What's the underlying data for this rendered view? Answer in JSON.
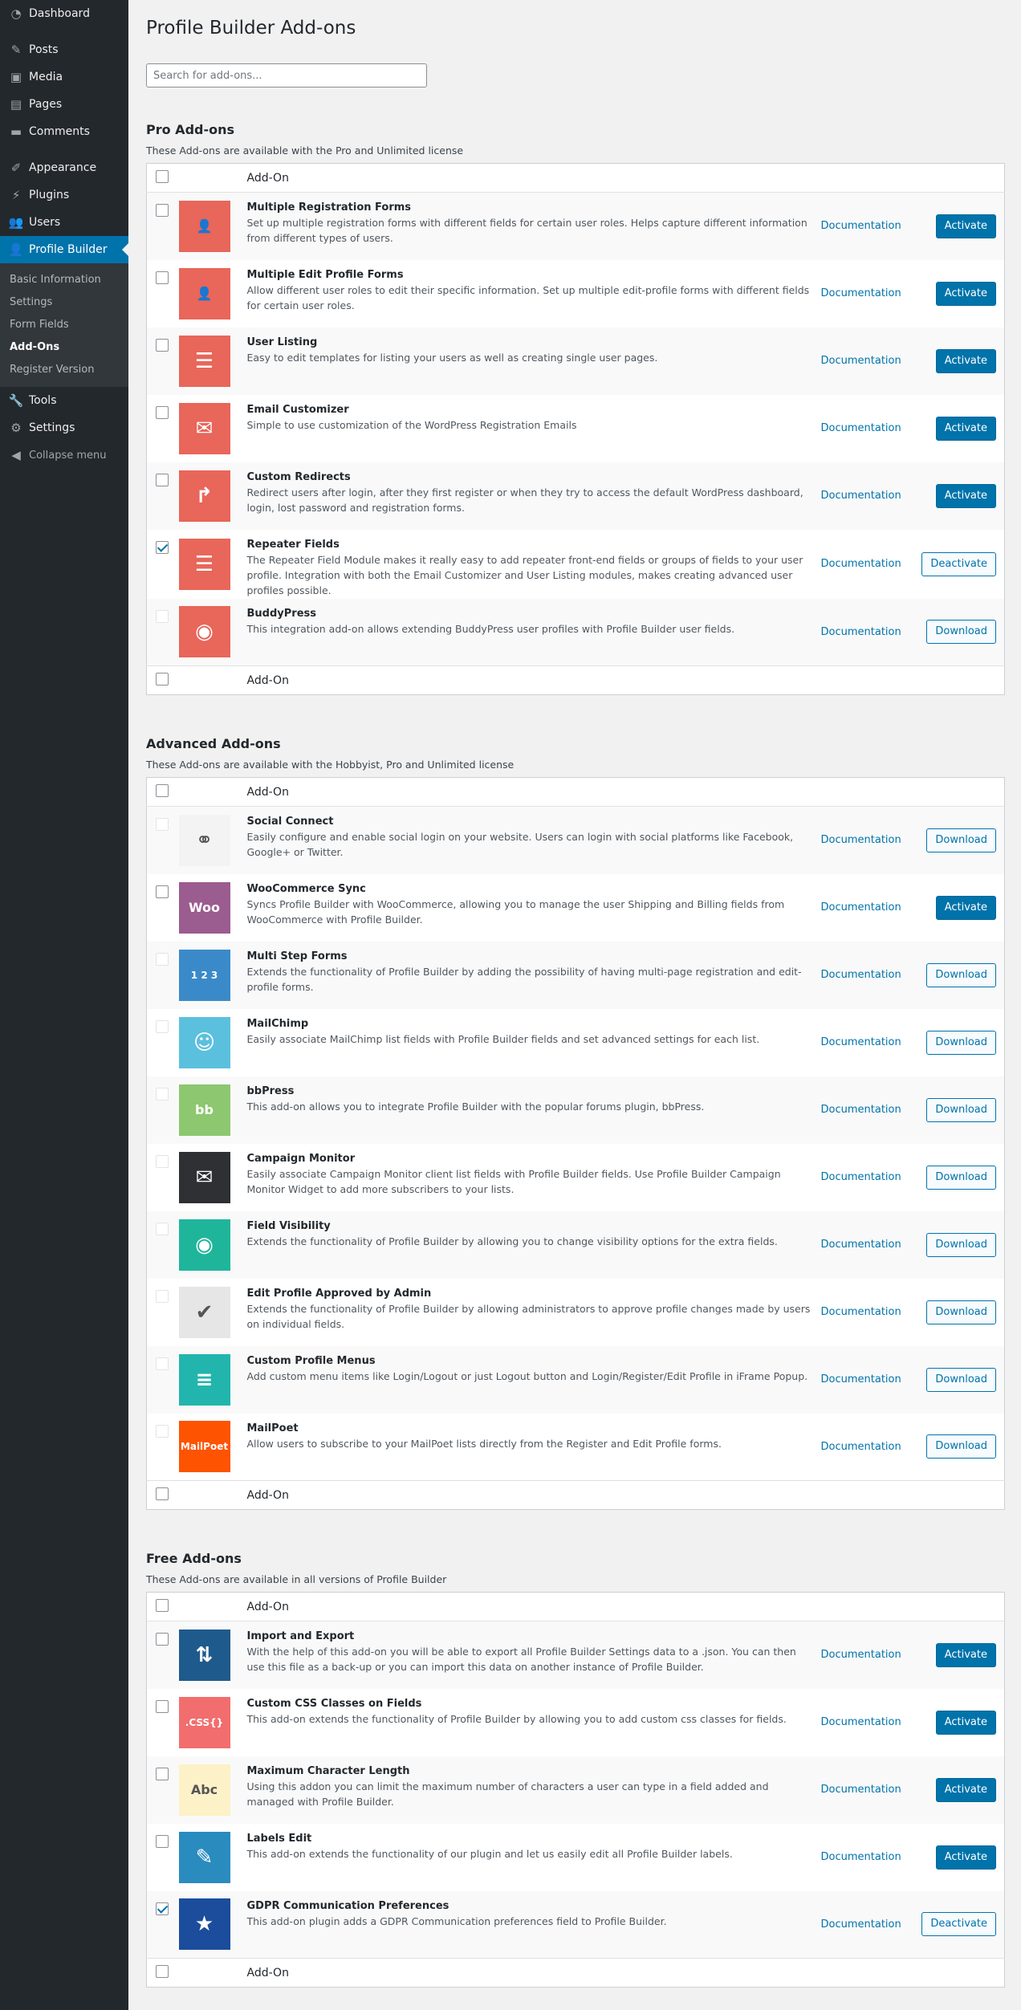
{
  "sidebar": {
    "items": [
      {
        "label": "Dashboard",
        "icon": "dashboard-icon"
      },
      {
        "label": "Posts",
        "icon": "pin-icon"
      },
      {
        "label": "Media",
        "icon": "media-icon"
      },
      {
        "label": "Pages",
        "icon": "pages-icon"
      },
      {
        "label": "Comments",
        "icon": "comments-icon"
      },
      {
        "label": "Appearance",
        "icon": "brush-icon"
      },
      {
        "label": "Plugins",
        "icon": "plug-icon"
      },
      {
        "label": "Users",
        "icon": "users-icon"
      },
      {
        "label": "Profile Builder",
        "icon": "user-icon"
      },
      {
        "label": "Tools",
        "icon": "wrench-icon"
      },
      {
        "label": "Settings",
        "icon": "settings-icon"
      }
    ],
    "submenu": [
      "Basic Information",
      "Settings",
      "Form Fields",
      "Add-Ons",
      "Register Version"
    ],
    "collapse": "Collapse menu"
  },
  "page": {
    "title": "Profile Builder Add-ons",
    "search_placeholder": "Search for add-ons..."
  },
  "labels": {
    "addon_col": "Add-On",
    "documentation": "Documentation"
  },
  "sections": [
    {
      "title": "Pro Add-ons",
      "desc": "These Add-ons are available with the Pro and Unlimited license",
      "addons": [
        {
          "name": "Multiple Registration Forms",
          "desc": "Set up multiple registration forms with different fields for certain user roles. Helps capture different information from different types of users.",
          "action": "Activate",
          "checked": false,
          "disabled": false,
          "color": "#e8665a",
          "glyph": "👤"
        },
        {
          "name": "Multiple Edit Profile Forms",
          "desc": "Allow different user roles to edit their specific information. Set up multiple edit-profile forms with different fields for certain user roles.",
          "action": "Activate",
          "checked": false,
          "disabled": false,
          "color": "#e8665a",
          "glyph": "👤"
        },
        {
          "name": "User Listing",
          "desc": "Easy to edit templates for listing your users as well as creating single user pages.",
          "action": "Activate",
          "checked": false,
          "disabled": false,
          "color": "#e8665a",
          "glyph": "☰"
        },
        {
          "name": "Email Customizer",
          "desc": "Simple to use customization of the WordPress Registration Emails",
          "action": "Activate",
          "checked": false,
          "disabled": false,
          "color": "#e8665a",
          "glyph": "✉"
        },
        {
          "name": "Custom Redirects",
          "desc": "Redirect users after login, after they first register or when they try to access the default WordPress dashboard, login, lost password and registration forms.",
          "action": "Activate",
          "checked": false,
          "disabled": false,
          "color": "#e8665a",
          "glyph": "↱"
        },
        {
          "name": "Repeater Fields",
          "desc": "The Repeater Field Module makes it really easy to add repeater front-end fields or groups of fields to your user profile. Integration with both the Email Customizer and User Listing modules, makes creating advanced user profiles possible.",
          "action": "Deactivate",
          "checked": true,
          "disabled": false,
          "color": "#e8665a",
          "glyph": "☰"
        },
        {
          "name": "BuddyPress",
          "desc": "This integration add-on allows extending BuddyPress user profiles with Profile Builder user fields.",
          "action": "Download",
          "checked": false,
          "disabled": true,
          "color": "#e8665a",
          "glyph": "◉"
        }
      ]
    },
    {
      "title": "Advanced Add-ons",
      "desc": "These Add-ons are available with the Hobbyist, Pro and Unlimited license",
      "addons": [
        {
          "name": "Social Connect",
          "desc": "Easily configure and enable social login on your website. Users can login with social platforms like Facebook, Google+ or Twitter.",
          "action": "Download",
          "checked": false,
          "disabled": true,
          "color": "#f3f3f3",
          "glyph": "⚭"
        },
        {
          "name": "WooCommerce Sync",
          "desc": "Syncs Profile Builder with WooCommerce, allowing you to manage the user Shipping and Billing fields from WooCommerce with Profile Builder.",
          "action": "Activate",
          "checked": false,
          "disabled": false,
          "color": "#9b5c8f",
          "glyph": "Woo"
        },
        {
          "name": "Multi Step Forms",
          "desc": "Extends the functionality of Profile Builder by adding the possibility of having multi-page registration and edit-profile forms.",
          "action": "Download",
          "checked": false,
          "disabled": true,
          "color": "#3a8ac9",
          "glyph": "1 2 3"
        },
        {
          "name": "MailChimp",
          "desc": "Easily associate MailChimp list fields with Profile Builder fields and set advanced settings for each list.",
          "action": "Download",
          "checked": false,
          "disabled": true,
          "color": "#5bc0de",
          "glyph": "☺"
        },
        {
          "name": "bbPress",
          "desc": "This add-on allows you to integrate Profile Builder with the popular forums plugin, bbPress.",
          "action": "Download",
          "checked": false,
          "disabled": true,
          "color": "#8dc770",
          "glyph": "bb"
        },
        {
          "name": "Campaign Monitor",
          "desc": "Easily associate Campaign Monitor client list fields with Profile Builder fields. Use Profile Builder Campaign Monitor Widget to add more subscribers to your lists.",
          "action": "Download",
          "checked": false,
          "disabled": true,
          "color": "#2e3033",
          "glyph": "✉"
        },
        {
          "name": "Field Visibility",
          "desc": "Extends the functionality of Profile Builder by allowing you to change visibility options for the extra fields.",
          "action": "Download",
          "checked": false,
          "disabled": true,
          "color": "#1fb59a",
          "glyph": "◉"
        },
        {
          "name": "Edit Profile Approved by Admin",
          "desc": "Extends the functionality of Profile Builder by allowing administrators to approve profile changes made by users on individual fields.",
          "action": "Download",
          "checked": false,
          "disabled": true,
          "color": "#e6e6e6",
          "glyph": "✔"
        },
        {
          "name": "Custom Profile Menus",
          "desc": "Add custom menu items like Login/Logout or just Logout button and Login/Register/Edit Profile in iFrame Popup.",
          "action": "Download",
          "checked": false,
          "disabled": true,
          "color": "#22b5ad",
          "glyph": "≡"
        },
        {
          "name": "MailPoet",
          "desc": "Allow users to subscribe to your MailPoet lists directly from the Register and Edit Profile forms.",
          "action": "Download",
          "checked": false,
          "disabled": true,
          "color": "#fe5301",
          "glyph": "MailPoet"
        }
      ]
    },
    {
      "title": "Free Add-ons",
      "desc": "These Add-ons are available in all versions of Profile Builder",
      "addons": [
        {
          "name": "Import and Export",
          "desc": "With the help of this add-on you will be able to export all Profile Builder Settings data to a .json. You can then use this file as a back-up or you can import this data on another instance of Profile Builder.",
          "action": "Activate",
          "checked": false,
          "disabled": false,
          "color": "#1f5a8c",
          "glyph": "⇅"
        },
        {
          "name": "Custom CSS Classes on Fields",
          "desc": "This add-on extends the functionality of Profile Builder by allowing you to add custom css classes for fields.",
          "action": "Activate",
          "checked": false,
          "disabled": false,
          "color": "#f26d6d",
          "glyph": ".CSS{}"
        },
        {
          "name": "Maximum Character Length",
          "desc": "Using this addon you can limit the maximum number of characters a user can type in a field added and managed with Profile Builder.",
          "action": "Activate",
          "checked": false,
          "disabled": false,
          "color": "#fdf1c7",
          "glyph": "Abc"
        },
        {
          "name": "Labels Edit",
          "desc": "This add-on extends the functionality of our plugin and let us easily edit all Profile Builder labels.",
          "action": "Activate",
          "checked": false,
          "disabled": false,
          "color": "#2a8bbf",
          "glyph": "✎"
        },
        {
          "name": "GDPR Communication Preferences",
          "desc": "This add-on plugin adds a GDPR Communication preferences field to Profile Builder.",
          "action": "Deactivate",
          "checked": true,
          "disabled": false,
          "color": "#1b4d9c",
          "glyph": "★"
        }
      ]
    }
  ]
}
